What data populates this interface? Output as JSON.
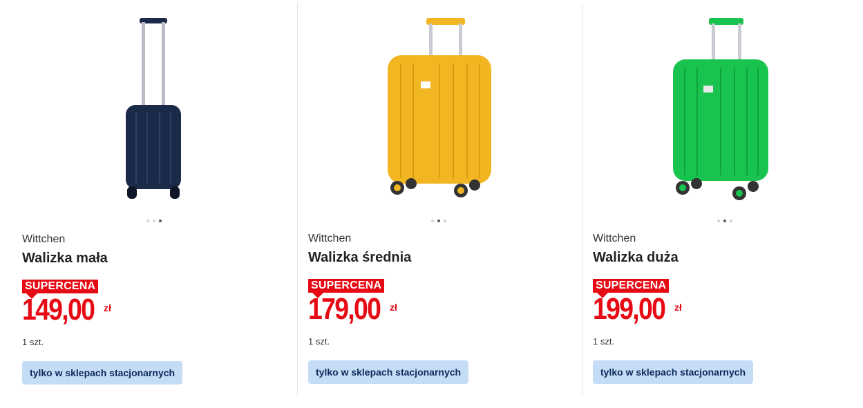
{
  "products": [
    {
      "brand": "Wittchen",
      "name": "Walizka mała",
      "badge": "SUPERCENA",
      "price": "149,00",
      "currency": "zł",
      "quantity": "1 szt.",
      "availability_label": "tylko w sklepach stacjonarnych",
      "suitcase_color": "#1c2a4a",
      "carousel": {
        "count": 3,
        "active_index": 3
      }
    },
    {
      "brand": "Wittchen",
      "name": "Walizka średnia",
      "badge": "SUPERCENA",
      "price": "179,00",
      "currency": "zł",
      "quantity": "1 szt.",
      "availability_label": "tylko w sklepach stacjonarnych",
      "suitcase_color": "#f2b623",
      "carousel": {
        "count": 3,
        "active_index": 2
      }
    },
    {
      "brand": "Wittchen",
      "name": "Walizka duża",
      "badge": "SUPERCENA",
      "price": "199,00",
      "currency": "zł",
      "quantity": "1 szt.",
      "availability_label": "tylko w sklepach stacjonarnych",
      "suitcase_color": "#19c34f",
      "carousel": {
        "count": 3,
        "active_index": 2
      }
    }
  ],
  "colors": {
    "accent_red": "#e60a14",
    "button_bg": "#c5dcf6",
    "button_text": "#0b2a5a"
  }
}
